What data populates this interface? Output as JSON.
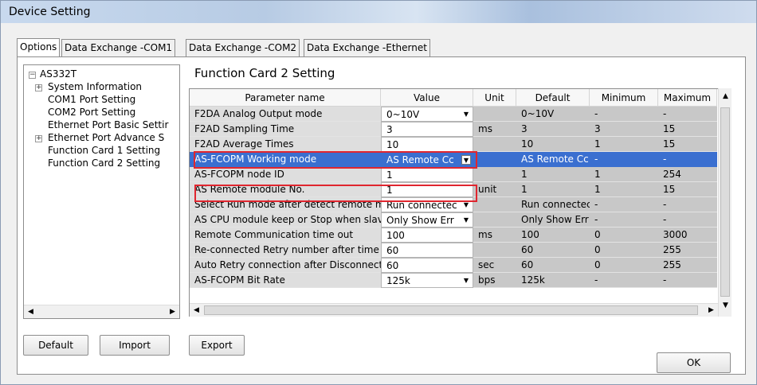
{
  "window": {
    "title": "Device Setting"
  },
  "tabs": [
    {
      "label": "Options"
    },
    {
      "label": "Data Exchange -COM1"
    },
    {
      "label": "Data Exchange -COM2"
    },
    {
      "label": "Data Exchange -Ethernet"
    }
  ],
  "tree": {
    "root": "AS332T",
    "items": [
      {
        "label": "System Information",
        "expander": "+"
      },
      {
        "label": "COM1 Port Setting"
      },
      {
        "label": "COM2 Port Setting"
      },
      {
        "label": "Ethernet Port Basic Settir"
      },
      {
        "label": "Ethernet Port Advance S",
        "expander": "+"
      },
      {
        "label": "Function Card 1 Setting"
      },
      {
        "label": "Function Card 2 Setting"
      }
    ]
  },
  "section_title": "Function Card 2 Setting",
  "grid": {
    "headers": [
      "Parameter name",
      "Value",
      "Unit",
      "Default",
      "Minimum",
      "Maximum"
    ],
    "rows": [
      {
        "name": "F2DA Analog Output mode",
        "value": "0~10V",
        "unit": "",
        "default": "0~10V",
        "min": "-",
        "max": "-"
      },
      {
        "name": "F2AD Sampling Time",
        "value": "3",
        "unit": "ms",
        "default": "3",
        "min": "3",
        "max": "15"
      },
      {
        "name": "F2AD Average Times",
        "value": "10",
        "unit": "",
        "default": "10",
        "min": "1",
        "max": "15"
      },
      {
        "name": "AS-FCOPM Working mode",
        "value": "AS Remote Cc",
        "unit": "",
        "default": "AS Remote Cc",
        "min": "-",
        "max": "-"
      },
      {
        "name": "AS-FCOPM node ID",
        "value": "1",
        "unit": "",
        "default": "1",
        "min": "1",
        "max": "254"
      },
      {
        "name": "AS Remote module No.",
        "value": "1",
        "unit": "unit",
        "default": "1",
        "min": "1",
        "max": "15"
      },
      {
        "name": "Select Run mode after detect remote mo",
        "value": "Run connectec",
        "unit": "",
        "default": "Run connectec",
        "min": "-",
        "max": "-"
      },
      {
        "name": "AS CPU module keep or Stop when slav",
        "value": "Only Show Err",
        "unit": "",
        "default": "Only Show Err",
        "min": "-",
        "max": "-"
      },
      {
        "name": "Remote Communication time out",
        "value": "100",
        "unit": "ms",
        "default": "100",
        "min": "0",
        "max": "3000"
      },
      {
        "name": "Re-connected Retry number after time o",
        "value": "60",
        "unit": "",
        "default": "60",
        "min": "0",
        "max": "255"
      },
      {
        "name": "Auto Retry connection after Disconnecte",
        "value": "60",
        "unit": "sec",
        "default": "60",
        "min": "0",
        "max": "255"
      },
      {
        "name": "AS-FCOPM Bit Rate",
        "value": "125k",
        "unit": "bps",
        "default": "125k",
        "min": "-",
        "max": "-"
      }
    ]
  },
  "buttons": {
    "default": "Default",
    "import": "Import",
    "export": "Export",
    "ok": "OK"
  },
  "colors": {
    "selection": "#3a6fd0",
    "highlight_box": "#e0262f"
  }
}
